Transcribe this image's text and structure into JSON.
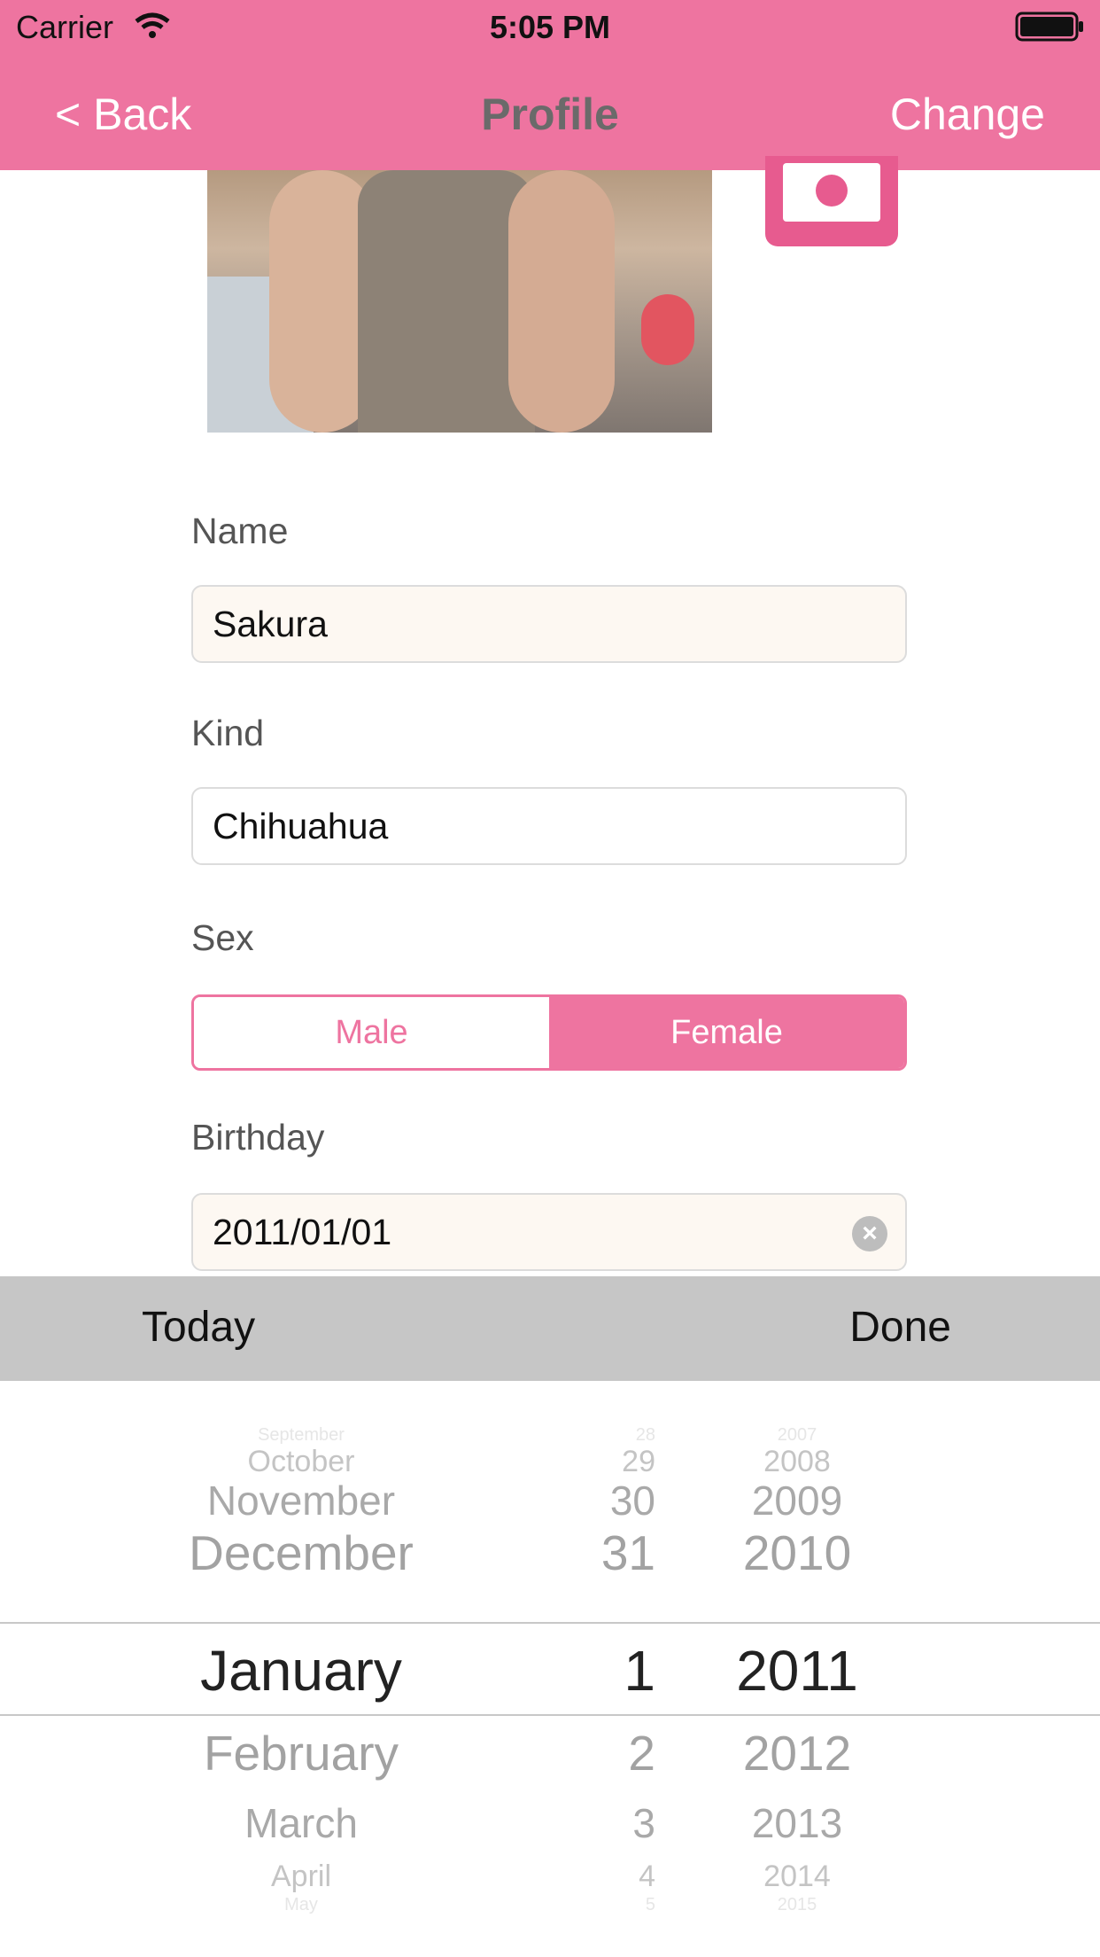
{
  "status_bar": {
    "carrier": "Carrier",
    "time": "5:05 PM"
  },
  "nav": {
    "back": "< Back",
    "title": "Profile",
    "change": "Change"
  },
  "form": {
    "name_label": "Name",
    "name_value": "Sakura",
    "kind_label": "Kind",
    "kind_value": "Chihuahua",
    "sex_label": "Sex",
    "sex_options": [
      "Male",
      "Female"
    ],
    "sex_selected": "Female",
    "birthday_label": "Birthday",
    "birthday_value": "2011/01/01"
  },
  "toolbar": {
    "today": "Today",
    "done": "Done"
  },
  "picker": {
    "months": [
      "September",
      "October",
      "November",
      "December",
      "January",
      "February",
      "March",
      "April",
      "May"
    ],
    "days": [
      "28",
      "29",
      "30",
      "31",
      "1",
      "2",
      "3",
      "4",
      "5"
    ],
    "years": [
      "2007",
      "2008",
      "2009",
      "2010",
      "2011",
      "2012",
      "2013",
      "2014",
      "2015"
    ],
    "selected": {
      "month": "January",
      "day": "1",
      "year": "2011"
    }
  },
  "colors": {
    "accent": "#ee74a0",
    "toolbar_bg": "#c6c6c6",
    "field_cream": "#fdf8f2"
  }
}
